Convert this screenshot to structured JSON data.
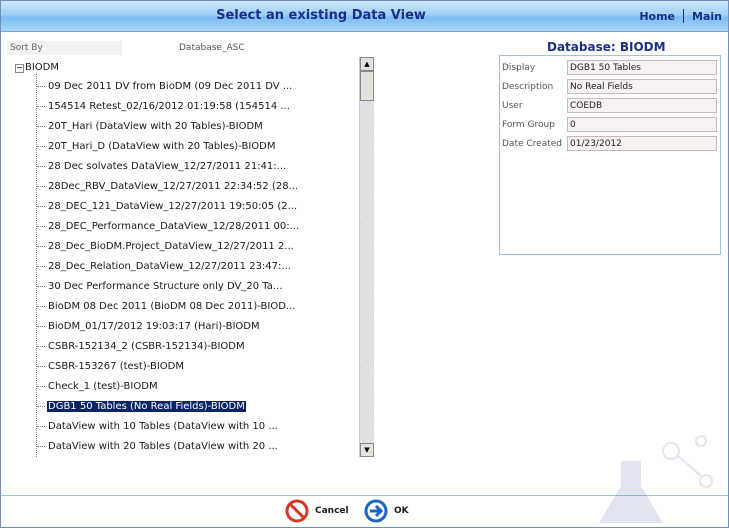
{
  "header": {
    "title": "Select an existing Data View",
    "home": "Home",
    "main": "Main"
  },
  "sort": {
    "label": "Sort By",
    "value": "Database_ASC"
  },
  "tree": {
    "root": "BIODM",
    "items": [
      {
        "label": "09 Dec 2011 DV from BioDM (09 Dec 2011 DV ..."
      },
      {
        "label": "154514 Retest_02/16/2012 01:19:58 (154514 ..."
      },
      {
        "label": "20T_Hari (DataView with 20 Tables)-BIODM"
      },
      {
        "label": "20T_Hari_D (DataView with 20 Tables)-BIODM"
      },
      {
        "label": "28 Dec solvates DataView_12/27/2011 21:41:..."
      },
      {
        "label": "28Dec_RBV_DataView_12/27/2011 22:34:52 (28..."
      },
      {
        "label": "28_DEC_121_DataView_12/27/2011 19:50:05 (2..."
      },
      {
        "label": "28_DEC_Performance_DataView_12/28/2011 00:..."
      },
      {
        "label": "28_Dec_BioDM.Project_DataView_12/27/2011 2..."
      },
      {
        "label": "28_Dec_Relation_DataView_12/27/2011 23:47:..."
      },
      {
        "label": "30 Dec Performance Structure only DV_20 Ta..."
      },
      {
        "label": "BioDM 08 Dec 2011 (BioDM 08 Dec 2011)-BIOD..."
      },
      {
        "label": "BioDM_01/17/2012 19:03:17 (Hari)-BIODM"
      },
      {
        "label": "CSBR-152134_2 (CSBR-152134)-BIODM"
      },
      {
        "label": "CSBR-153267 (test)-BIODM"
      },
      {
        "label": "Check_1 (test)-BIODM"
      },
      {
        "label": "DGB1 50 Tables (No Real Fields)-BIODM",
        "selected": true
      },
      {
        "label": "DataView with 10 Tables (DataView with 10 ..."
      },
      {
        "label": "DataView with 20 Tables (DataView with 20 ..."
      }
    ]
  },
  "details": {
    "title": "Database: BIODM",
    "fields": [
      {
        "key": "Display",
        "value": "DGB1 50 Tables"
      },
      {
        "key": "Description",
        "value": "No Real Fields"
      },
      {
        "key": "User",
        "value": "COEDB"
      },
      {
        "key": "Form Group",
        "value": "0"
      },
      {
        "key": "Date Created",
        "value": "01/23/2012"
      }
    ]
  },
  "footer": {
    "cancel": "Cancel",
    "ok": "OK"
  },
  "colors": {
    "title_text": "#1b2f8a",
    "selected_bg": "#0a246a",
    "cancel_icon": "#d4372a",
    "ok_icon": "#1d63c7"
  }
}
